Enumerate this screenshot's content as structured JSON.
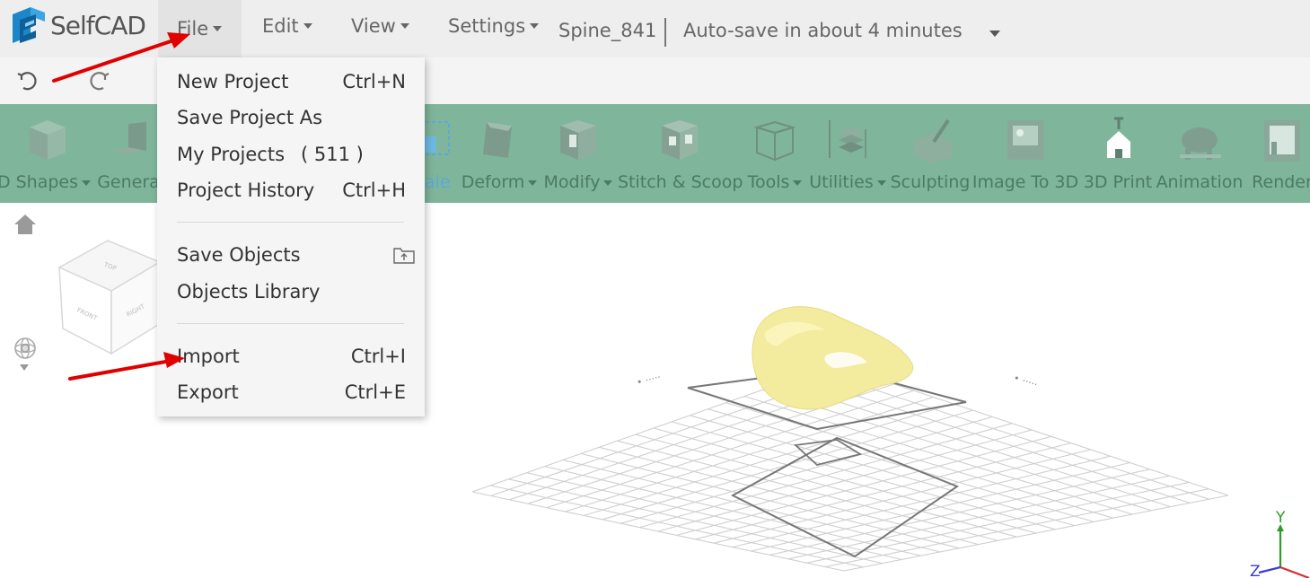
{
  "app": {
    "logo_text": "SelfCAD"
  },
  "menu": {
    "file": "File",
    "edit": "Edit",
    "view": "View",
    "settings": "Settings"
  },
  "project": {
    "name": "Spine_841",
    "autosave": "Auto-save in about 4 minutes"
  },
  "toolbar": {
    "items": [
      {
        "label": "D Shapes",
        "icon": "cube-icon",
        "dropdown": true
      },
      {
        "label": "Genera",
        "icon": "generator-icon",
        "dropdown": false
      },
      {
        "label": "cale",
        "icon": "scale-icon",
        "dropdown": false
      },
      {
        "label": "Deform",
        "icon": "deform-icon",
        "dropdown": true
      },
      {
        "label": "Modify",
        "icon": "modify-icon",
        "dropdown": true
      },
      {
        "label": "Stitch & Scoop",
        "icon": "stitch-scoop-icon",
        "dropdown": false
      },
      {
        "label": "Tools",
        "icon": "tools-icon",
        "dropdown": true
      },
      {
        "label": "Utilities",
        "icon": "utilities-icon",
        "dropdown": true
      },
      {
        "label": "Sculpting",
        "icon": "sculpting-icon",
        "dropdown": false
      },
      {
        "label": "Image To 3D",
        "icon": "image-to-3d-icon",
        "dropdown": false
      },
      {
        "label": "3D Print",
        "icon": "3d-print-icon",
        "dropdown": false
      },
      {
        "label": "Animation",
        "icon": "animation-icon",
        "dropdown": false
      },
      {
        "label": "Render",
        "icon": "render-icon",
        "dropdown": false
      }
    ]
  },
  "file_menu": {
    "new_project": {
      "label": "New Project",
      "shortcut": "Ctrl+N"
    },
    "save_project_as": {
      "label": "Save Project As"
    },
    "my_projects": {
      "label": "My Projects",
      "count": "( 511 )"
    },
    "project_history": {
      "label": "Project History",
      "shortcut": "Ctrl+H"
    },
    "save_objects": {
      "label": "Save Objects",
      "icon": "folder-upload-icon"
    },
    "objects_library": {
      "label": "Objects Library"
    },
    "import": {
      "label": "Import",
      "shortcut": "Ctrl+I"
    },
    "export": {
      "label": "Export",
      "shortcut": "Ctrl+E"
    }
  },
  "viewcube": {
    "top": "TOP",
    "front": "FRONT",
    "right": "RIGHT"
  },
  "axes": {
    "y": "Y",
    "z": "Z"
  },
  "colors": {
    "toolbar_bg": "#7fb59b",
    "model_color": "#f3eb9e",
    "annotation_arrow": "#e00000",
    "axis_y": "#2e9b2e",
    "axis_z": "#3a3ad6",
    "axis_x": "#d62e2e"
  }
}
